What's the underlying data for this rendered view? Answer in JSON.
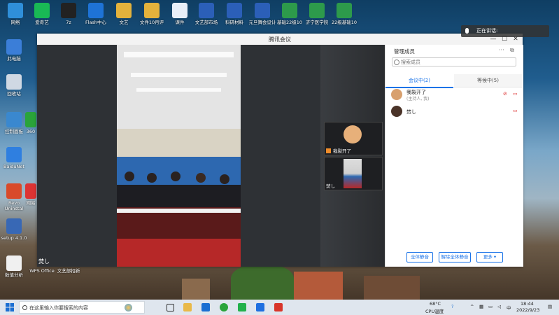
{
  "desktop": {
    "icons": [
      {
        "label": "网络",
        "color": "#2f8fd9"
      },
      {
        "label": "爱奇艺",
        "color": "#19b955"
      },
      {
        "label": "7z",
        "color": "#222222"
      },
      {
        "label": "Flash中心",
        "color": "#1e73d6"
      },
      {
        "label": "文艺",
        "color": "#e3b23c"
      },
      {
        "label": "文件10月评",
        "color": "#e3b23c"
      },
      {
        "label": "课件",
        "color": "#e8eef8"
      },
      {
        "label": "文艺部市场",
        "color": "#2b5fb8"
      },
      {
        "label": "科研材料",
        "color": "#2b5fb8"
      },
      {
        "label": "元旦舞会设计",
        "color": "#2b5fb8"
      },
      {
        "label": "基础22级10",
        "color": "#2d9a4b"
      },
      {
        "label": "济宁医学院",
        "color": "#2d9a4b"
      },
      {
        "label": "22级基础10",
        "color": "#2d9a4b"
      },
      {
        "label": "此电脑",
        "color": "#3b7ed8"
      },
      {
        "label": "回收站",
        "color": "#cfd8e3"
      },
      {
        "label": "控制面板",
        "color": "#3a88cf"
      },
      {
        "label": "BaiduNet",
        "color": "#2f7fe0"
      },
      {
        "label": "Revo Uninstal",
        "color": "#d94a2a"
      },
      {
        "label": "setup 4.1.0",
        "color": "#3868b5"
      },
      {
        "label": "数值分析",
        "color": "#f0f0f0"
      },
      {
        "label": "WPS Office",
        "color": "#d8352a"
      },
      {
        "label": "文艺部招新",
        "color": "#2b5fb8"
      },
      {
        "label": "360",
        "color": "#2aa43a"
      },
      {
        "label": "网易",
        "color": "#d33"
      }
    ]
  },
  "meeting": {
    "title": "腾讯会议",
    "min_icon": "—",
    "max_icon": "☐",
    "close_icon": "✕",
    "speaker_name": "焚し",
    "thumbnails": [
      {
        "name": "我裂开了"
      },
      {
        "name": "焚し"
      }
    ]
  },
  "members_panel": {
    "title": "管理成员",
    "more_icon": "···",
    "popout_icon": "⧉",
    "search_placeholder": "搜索成员",
    "tab_in_meeting": "会议中(2)",
    "tab_waiting": "等候中(5)",
    "members": [
      {
        "name": "我裂开了",
        "role": "(主持人, 我)"
      },
      {
        "name": "焚し",
        "role": ""
      }
    ],
    "btn_mute_all": "全体静音",
    "btn_unmute_all": "解除全体静音",
    "btn_more": "更多 ▾"
  },
  "notification": {
    "speaking_label": "正在讲话:"
  },
  "taskbar": {
    "search_placeholder": "在这里输入你要搜索的内容",
    "weather_temp": "68°C",
    "weather_label": "CPU温度",
    "ime": "中",
    "time": "18:44",
    "date": "2022/9/23"
  }
}
